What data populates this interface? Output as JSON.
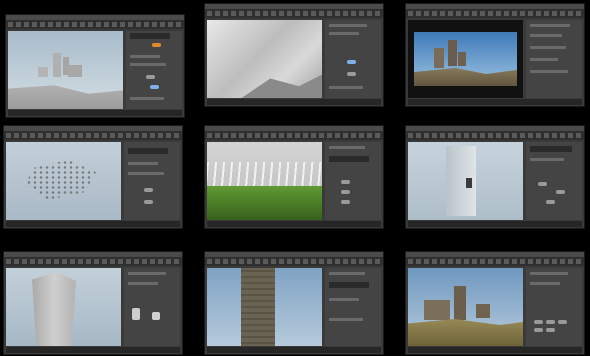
{
  "layout_title": "",
  "tiles": [
    {
      "id": "tile-1",
      "scene": "grey-blockout-buildings"
    },
    {
      "id": "tile-2",
      "scene": "white-terrain-heightfield"
    },
    {
      "id": "tile-3",
      "scene": "rendered-castle-ruins-sky"
    },
    {
      "id": "tile-4",
      "scene": "scattered-rock-points"
    },
    {
      "id": "tile-5",
      "scene": "grass-and-foliage"
    },
    {
      "id": "tile-6",
      "scene": "tall-pillar-ivy"
    },
    {
      "id": "tile-7",
      "scene": "hollow-tower-model"
    },
    {
      "id": "tile-8",
      "scene": "stone-tower-closeup"
    },
    {
      "id": "tile-9",
      "scene": "final-castle-render"
    }
  ],
  "colors": {
    "background": "#000000",
    "panel": "#444444",
    "ui_dark": "#3a3a3a",
    "node_accent": "#e08a2a",
    "node_blue": "#7fb0e8",
    "sky": "#9db3c6",
    "grass": "#4f8a2a"
  }
}
